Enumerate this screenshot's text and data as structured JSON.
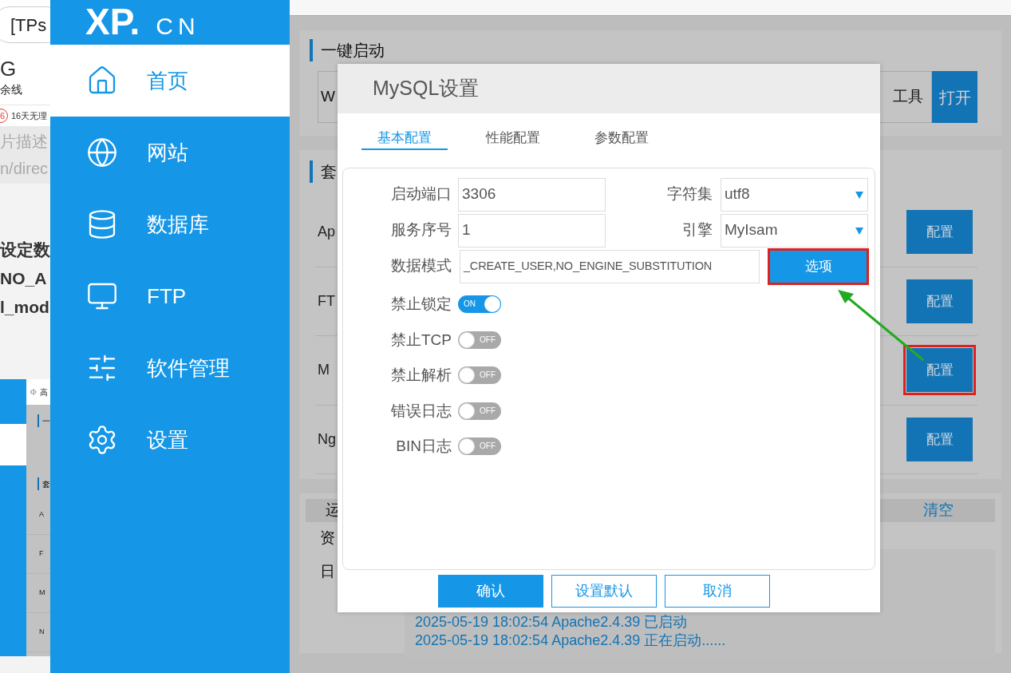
{
  "background_browser": {
    "address": "[TPs",
    "heading": "G",
    "subtext": "余线",
    "badge": "6",
    "notice": "16天无理",
    "lines": [
      "片描述",
      "n/direc"
    ],
    "article": [
      "设定数",
      "NO_A",
      "l_mod"
    ],
    "mini_window": {
      "top": "高",
      "panel_title": "一",
      "section": "套",
      "rows": [
        "A",
        "F",
        "M",
        "N"
      ]
    }
  },
  "app": {
    "logo": {
      "main": "XP.",
      "suffix": "CN"
    },
    "nav": [
      {
        "label": "首页",
        "selected": true
      },
      {
        "label": "网站",
        "selected": false
      },
      {
        "label": "数据库",
        "selected": false
      },
      {
        "label": "FTP",
        "selected": false
      },
      {
        "label": "软件管理",
        "selected": false
      },
      {
        "label": "设置",
        "selected": false
      }
    ],
    "quick_start": {
      "title": "一键启动",
      "field": "W",
      "tool_label": "工具",
      "open_button": "打开"
    },
    "suite": {
      "title": "套",
      "rows": [
        {
          "name": "Ap",
          "button": "配置",
          "highlighted": false
        },
        {
          "name": "FT",
          "button": "配置",
          "highlighted": false
        },
        {
          "name": "M",
          "button": "配置",
          "highlighted": true
        },
        {
          "name": "Ng",
          "button": "配置",
          "highlighted": false
        }
      ]
    },
    "log": {
      "header": "运",
      "clear": "清空",
      "labels": [
        "资",
        "日"
      ],
      "lines": [
        "2025-05-19 18:02:54 Apache2.4.39 已启动",
        "2025-05-19 18:02:54 Apache2.4.39 正在启动......"
      ]
    }
  },
  "modal": {
    "title": "MySQL设置",
    "tabs": [
      {
        "label": "基本配置",
        "selected": true
      },
      {
        "label": "性能配置",
        "selected": false
      },
      {
        "label": "参数配置",
        "selected": false
      }
    ],
    "port": {
      "label": "启动端口",
      "value": "3306"
    },
    "charset": {
      "label": "字符集",
      "value": "utf8"
    },
    "server_id": {
      "label": "服务序号",
      "value": "1"
    },
    "engine": {
      "label": "引擎",
      "value": "MyIsam"
    },
    "sql_mode": {
      "label": "数据模式",
      "value": "_CREATE_USER,NO_ENGINE_SUBSTITUTION",
      "button": "选项",
      "highlighted": true
    },
    "toggles": [
      {
        "label": "禁止锁定",
        "on": true,
        "state_text": "ON"
      },
      {
        "label": "禁止TCP",
        "on": false,
        "state_text": "OFF"
      },
      {
        "label": "禁止解析",
        "on": false,
        "state_text": "OFF"
      },
      {
        "label": "错误日志",
        "on": false,
        "state_text": "OFF"
      },
      {
        "label": "BIN日志",
        "on": false,
        "state_text": "OFF"
      }
    ],
    "buttons": [
      {
        "label": "确认",
        "kind": "primary"
      },
      {
        "label": "设置默认",
        "kind": "outline"
      },
      {
        "label": "取消",
        "kind": "outline"
      }
    ]
  }
}
